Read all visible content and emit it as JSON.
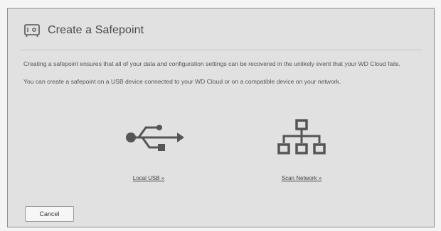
{
  "dialog": {
    "title": "Create a Safepoint",
    "title_icon": "safepoint-icon",
    "description": "Creating a safepoint ensures that all of your data and configuration settings can be recovered in the unlikely event that your WD Cloud fails.",
    "instructions": "You can create a safepoint on a USB device connected to your WD Cloud or on a compatible device on your network."
  },
  "options": {
    "usb": {
      "label": "Local USB »",
      "icon": "usb-icon"
    },
    "network": {
      "label": "Scan Network »",
      "icon": "network-icon"
    }
  },
  "footer": {
    "cancel_label": "Cancel"
  },
  "colors": {
    "dialog_bg": "#e1e1e1",
    "icon": "#555555",
    "text": "#555555"
  }
}
